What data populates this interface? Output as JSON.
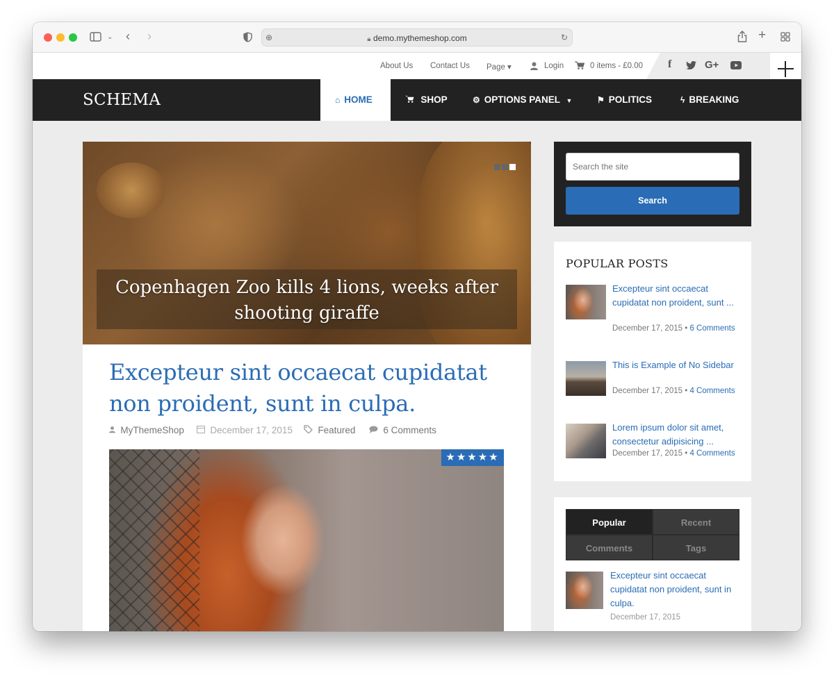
{
  "browser": {
    "url": "demo.mythemeshop.com"
  },
  "topbar": {
    "links": [
      "About Us",
      "Contact Us",
      "Page ▾"
    ],
    "login": "Login",
    "cart": "0 items - £0.00",
    "social_icons": [
      "facebook-icon",
      "twitter-icon",
      "google-plus-icon",
      "youtube-icon"
    ]
  },
  "header": {
    "logo": "SCHEMA",
    "nav": [
      {
        "label": "HOME",
        "icon": "home-icon"
      },
      {
        "label": "SHOP",
        "icon": "cart-icon"
      },
      {
        "label": "OPTIONS PANEL",
        "icon": "gears-icon"
      },
      {
        "label": "POLITICS",
        "icon": "flag-icon"
      },
      {
        "label": "BREAKING",
        "icon": "bolt-icon"
      }
    ]
  },
  "slider": {
    "caption": "Copenhagen Zoo kills 4 lions, weeks after shooting giraffe",
    "dot_count": 3,
    "active_dot": 3
  },
  "post": {
    "title": "Excepteur sint occaecat cupidatat non proident, sunt in culpa.",
    "author": "MyThemeShop",
    "date": "December 17, 2015",
    "category": "Featured",
    "comments": "6 Comments",
    "rating_stars": 5
  },
  "search": {
    "placeholder": "Search the site",
    "button": "Search"
  },
  "popular_posts": {
    "title": "POPULAR POSTS",
    "items": [
      {
        "title": "Excepteur sint occaecat cupidatat non proident, sunt ...",
        "date": "December 17, 2015",
        "comments": "6 Comments"
      },
      {
        "title": "This is Example of No Sidebar",
        "date": "December 17, 2015",
        "comments": "4 Comments"
      },
      {
        "title": "Lorem ipsum dolor sit amet, consectetur adipisicing ...",
        "date": "December 17, 2015",
        "comments": "4 Comments"
      }
    ]
  },
  "tabs_widget": {
    "tabs": [
      "Popular",
      "Recent",
      "Comments",
      "Tags"
    ],
    "active": "Popular",
    "item": {
      "title": "Excepteur sint occaecat cupidatat non proident, sunt in culpa.",
      "date": "December 17, 2015"
    }
  },
  "colors": {
    "accent": "#2a6cb5",
    "nav_bg": "#222222",
    "page_bg": "#ececec"
  }
}
